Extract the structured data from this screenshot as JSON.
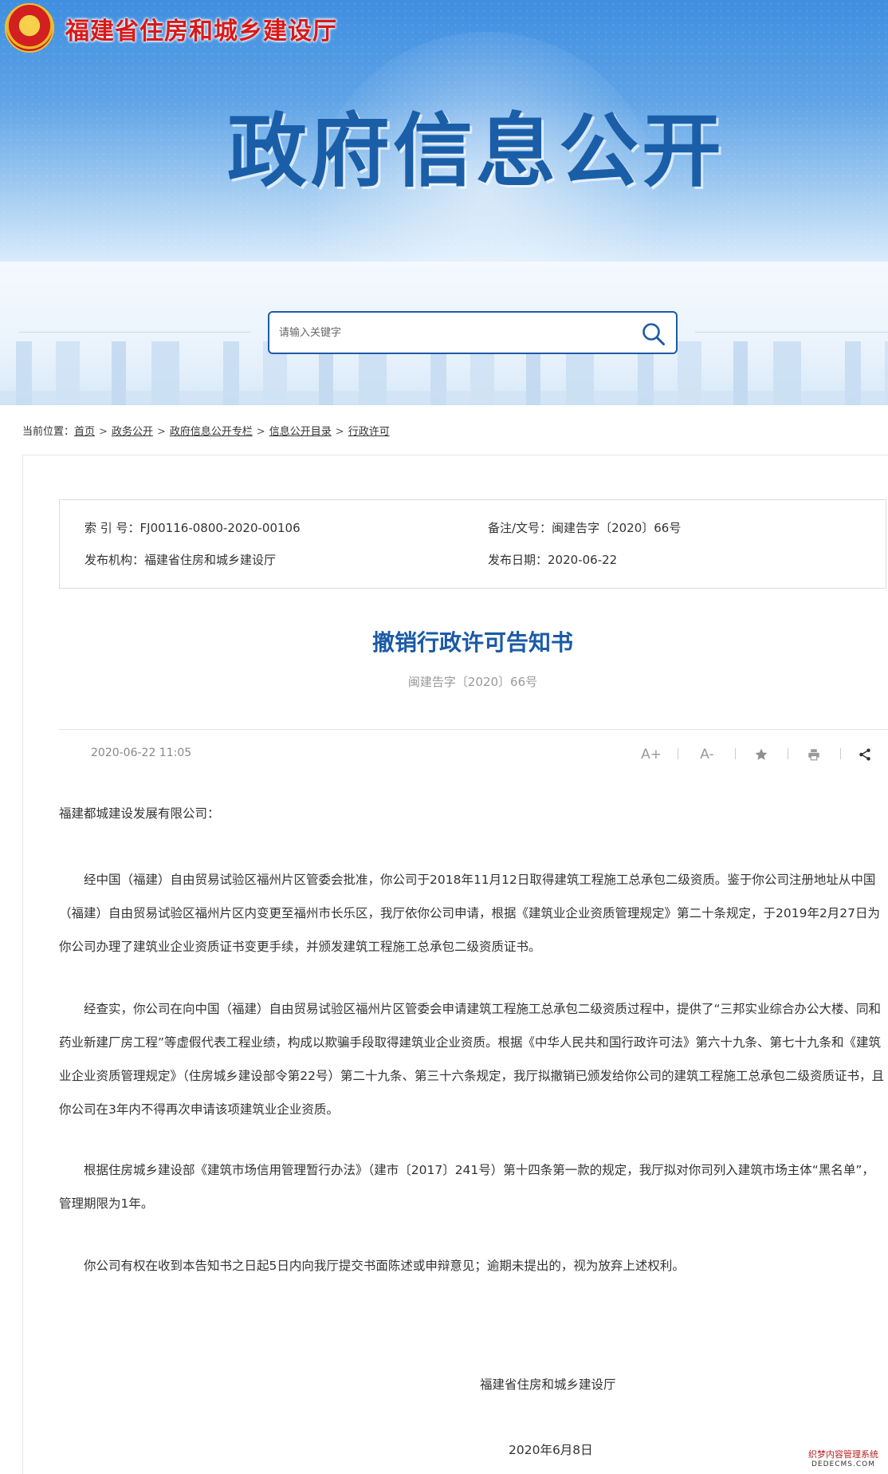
{
  "header": {
    "org_name": "福建省住房和城乡建设厅",
    "banner_title": "政府信息公开"
  },
  "search": {
    "placeholder": "请输入关键字",
    "icon": "search-icon"
  },
  "breadcrumb": {
    "prefix": "当前位置：",
    "items": [
      "首页",
      "政务公开",
      "政府信息公开专栏",
      "信息公开目录",
      "行政许可"
    ],
    "separator": ">"
  },
  "meta": {
    "index_label": "索 引 号：",
    "index_value": "FJ00116-0800-2020-00106",
    "docno_label": "备注/文号：",
    "docno_value": "闽建告字〔2020〕66号",
    "publisher_label": "发布机构：",
    "publisher_value": "福建省住房和城乡建设厅",
    "date_label": "发布日期：",
    "date_value": "2020-06-22"
  },
  "article": {
    "title": "撤销行政许可告知书",
    "subtitle": "闽建告字〔2020〕66号",
    "publish_time": "2020-06-22 11:05",
    "salutation": "福建都城建设发展有限公司：",
    "paragraphs": [
      "经中国（福建）自由贸易试验区福州片区管委会批准，你公司于2018年11月12日取得建筑工程施工总承包二级资质。鉴于你公司注册地址从中国（福建）自由贸易试验区福州片区内变更至福州市长乐区，我厅依你公司申请，根据《建筑业企业资质管理规定》第二十条规定，于2019年2月27日为你公司办理了建筑业企业资质证书变更手续，并颁发建筑工程施工总承包二级资质证书。",
      "经查实，你公司在向中国（福建）自由贸易试验区福州片区管委会申请建筑工程施工总承包二级资质过程中，提供了“三邦实业综合办公大楼、同和药业新建厂房工程”等虚假代表工程业绩，构成以欺骗手段取得建筑业企业资质。根据《中华人民共和国行政许可法》第六十九条、第七十九条和《建筑业企业资质管理规定》（住房城乡建设部令第22号）第二十九条、第三十六条规定，我厅拟撤销已颁发给你公司的建筑工程施工总承包二级资质证书，且你公司在3年内不得再次申请该项建筑业企业资质。",
      "根据住房城乡建设部《建筑市场信用管理暂行办法》（建市〔2017〕241号）第十四条第一款的规定，我厅拟对你司列入建筑市场主体“黑名单”，管理期限为1年。",
      "你公司有权在收到本告知书之日起5日内向我厅提交书面陈述或申辩意见；逾期未提出的，视为放弃上述权利。"
    ],
    "signature_org": "福建省住房和城乡建设厅",
    "signature_date": "2020年6月8日"
  },
  "tools": {
    "font_increase": "A+",
    "font_decrease": "A-"
  },
  "watermark": {
    "line1": "织梦内容管理系统",
    "line2": "DEDECMS.COM"
  }
}
